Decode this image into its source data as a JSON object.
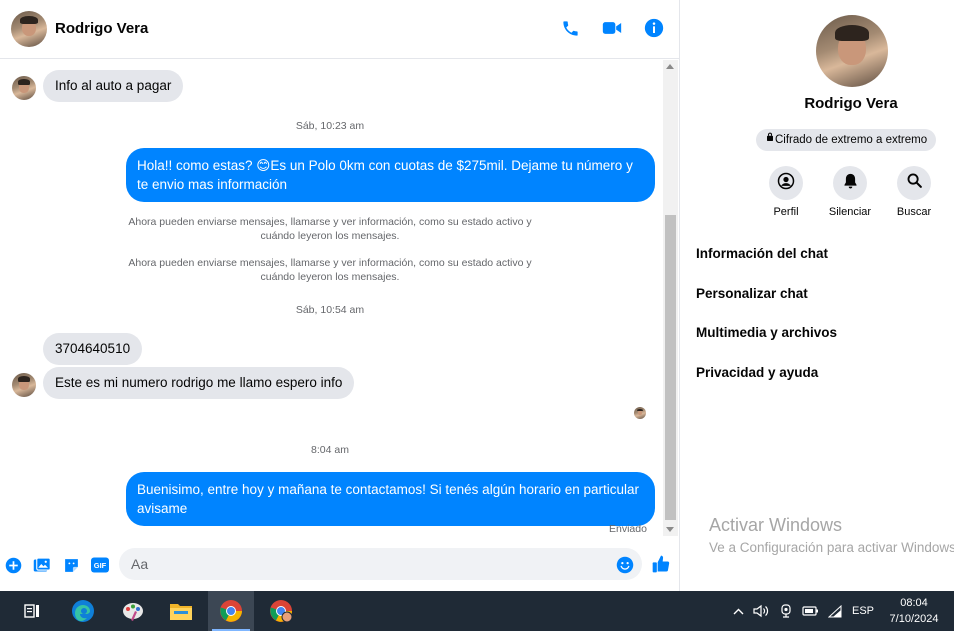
{
  "contact": {
    "name": "Rodrigo Vera"
  },
  "messages": {
    "m1": "Info al auto a pagar",
    "ts1": "Sáb, 10:23 am",
    "m2": "Hola!! como estas? 😊Es un Polo 0km con cuotas de $275mil. Dejame tu número y te envio mas información",
    "sys1": "Ahora pueden enviarse mensajes, llamarse y ver información, como su estado activo y cuándo leyeron los mensajes.",
    "sys2": "Ahora pueden enviarse mensajes, llamarse y ver información, como su estado activo y cuándo leyeron los mensajes.",
    "ts2": "Sáb, 10:54 am",
    "m3": "3704640510",
    "m4": "Este es mi numero rodrigo me llamo espero info",
    "ts3": "8:04 am",
    "m5": "Buenisimo, entre hoy y mañana te contactamos! Si tenés algún horario en particular avisame",
    "status": "Enviado"
  },
  "composer": {
    "placeholder": "Aa"
  },
  "info": {
    "e2e": "Cifrado de extremo a extremo",
    "actions": {
      "profile": "Perfil",
      "mute": "Silenciar",
      "search": "Buscar"
    },
    "menu": [
      "Información del chat",
      "Personalizar chat",
      "Multimedia y archivos",
      "Privacidad y ayuda"
    ]
  },
  "watermark": {
    "title": "Activar Windows",
    "subtitle": "Ve a Configuración para activar Windows."
  },
  "taskbar": {
    "lang": "ESP",
    "time": "08:04",
    "date": "7/10/2024"
  },
  "colors": {
    "accent": "#0084ff",
    "bubble_in": "#e4e6eb",
    "taskbar": "#1f2a36"
  },
  "icons": [
    "phone-icon",
    "video-camera-icon",
    "info-icon",
    "plus-icon",
    "image-icon",
    "sticker-icon",
    "gif-icon",
    "emoji-icon",
    "like-icon",
    "lock-icon",
    "profile-icon",
    "bell-icon",
    "search-icon"
  ]
}
